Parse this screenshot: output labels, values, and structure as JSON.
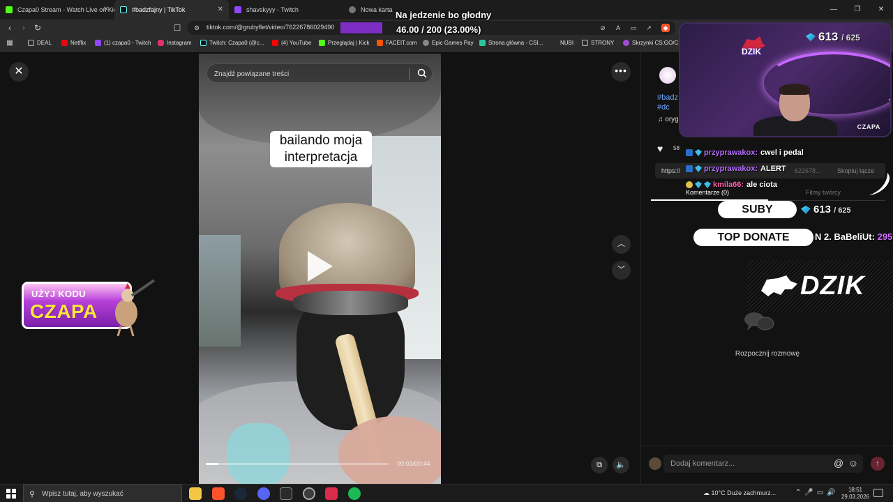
{
  "browser": {
    "tabs": [
      {
        "label": "Czapa0 Stream - Watch Live on Kick",
        "favicon_color": "#53fc18",
        "active": false
      },
      {
        "label": "#badzfajny | TikTok",
        "favicon_color": "#111111",
        "active": true
      },
      {
        "label": "shavskyyy - Twitch",
        "favicon_color": "#9146ff",
        "active": false
      },
      {
        "label": "Nowa karta",
        "favicon_color": "#777777",
        "active": false
      }
    ],
    "url": "tiktok.com/@grubyflet/video/76226786029490",
    "bookmarks": [
      {
        "label": "DEAL",
        "color": "#888888"
      },
      {
        "label": "Netflix",
        "color": "#e50914"
      },
      {
        "label": "(1) czapa0 - Twitch",
        "color": "#9146ff"
      },
      {
        "label": "Instagram",
        "color": "#e1306c"
      },
      {
        "label": "Twitch: Czapa0 (@c...",
        "color": "#111111"
      },
      {
        "label": "(4) YouTube",
        "color": "#ff0000"
      },
      {
        "label": "Przeglądaj | Kick",
        "color": "#53fc18"
      },
      {
        "label": "FACEIT.com",
        "color": "#ff5500"
      },
      {
        "label": "Epic Games Pay",
        "color": "#555555"
      },
      {
        "label": "Strona główna - CSI...",
        "color": "#2ec4a0"
      },
      {
        "label": "NUBI",
        "color": "#2b2b2b"
      },
      {
        "label": "STRONY",
        "color": "#888888"
      },
      {
        "label": "Skrzynki CS:GO/CS...",
        "color": "#a24bd6"
      }
    ]
  },
  "video": {
    "search_placeholder": "Znajdź powiązane treści",
    "caption_line1": "bailando moja",
    "caption_line2": "interpretacja",
    "time": "00:03/00:44",
    "progress": 0.07
  },
  "sidebar": {
    "hashtag1": "#badz",
    "hashtag2": "#dc",
    "sound": "♫  oryg",
    "likes": "58",
    "link": "https://",
    "link_tail": "622678...",
    "copy_link": "Skopiuj łącze",
    "tab_comments": "Komentarze (0)",
    "tab_creator": "Filmy twórcy",
    "empty_text": "Rozpocznij rozmowę",
    "comment_placeholder": "Dodaj komentarz..."
  },
  "overlay": {
    "goal_title": "Na jedzenie bo głodny",
    "goal_value": "46.00 / 200 (23.00%)",
    "cam_logo": "DZIK",
    "cam_count": "613",
    "cam_count_max": "/ 625",
    "cam_label": "CZAPA",
    "chat": [
      {
        "user": "przyprawakox:",
        "msg": "cwel i pedal",
        "user_color": "#b36bff",
        "badge": "blue"
      },
      {
        "user": "przyprawakox:",
        "msg": "ALERT",
        "user_color": "#b36bff",
        "badge": "blue"
      },
      {
        "user": "kmila66:",
        "msg": "ale ciota",
        "user_color": "#ff5fae",
        "badge": "moon"
      }
    ],
    "suby_label": "SUBY",
    "suby_count": "613",
    "suby_max": "/ 625",
    "top_label": "TOP DONATE",
    "top_donor": "N 2. BaBeliUt:",
    "top_amount": "295",
    "banner": "DZIK",
    "promo_line1": "UŻYJ KODU",
    "promo_line2": "CZAPA"
  },
  "taskbar": {
    "search": "Wpisz tutaj, aby wyszukać",
    "weather": "10°C  Duże zachmurz...",
    "time": "18:51",
    "date": "29.03.2026",
    "apps": [
      {
        "name": "file-explorer",
        "color": "#f3c744"
      },
      {
        "name": "brave",
        "color": "#fb542b"
      },
      {
        "name": "steam",
        "color": "#1b2838"
      },
      {
        "name": "discord",
        "color": "#5865f2"
      },
      {
        "name": "epic-games",
        "color": "#2a2a2a"
      },
      {
        "name": "chrome",
        "color": "#3c3c3c"
      },
      {
        "name": "affinity",
        "color": "#d92c4a"
      },
      {
        "name": "spotify",
        "color": "#1db954"
      }
    ]
  }
}
